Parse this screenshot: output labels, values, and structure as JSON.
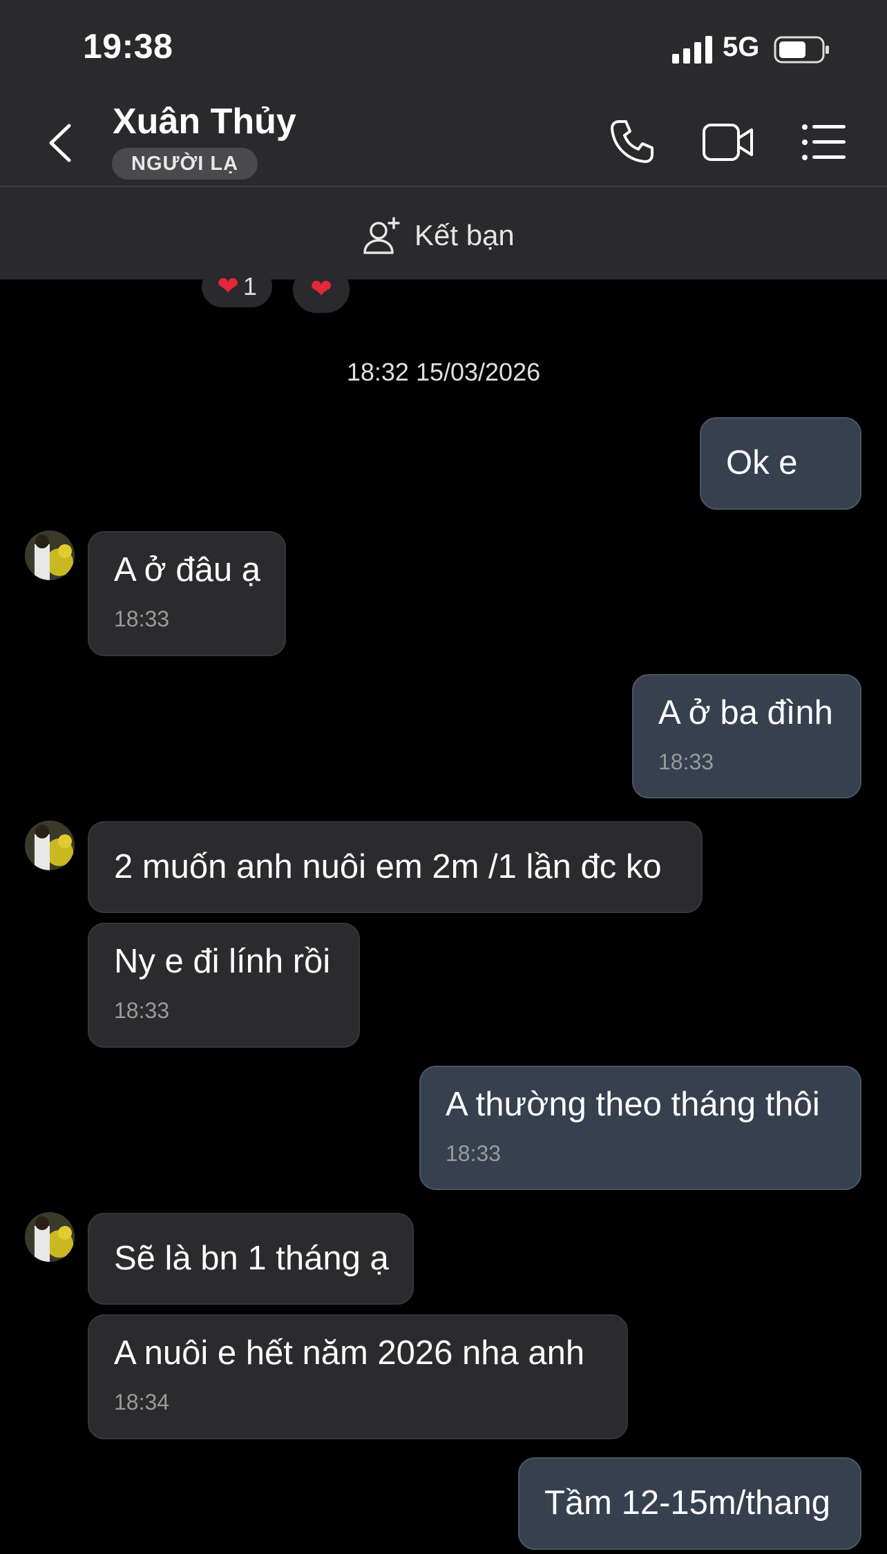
{
  "status_bar": {
    "time": "19:38",
    "network": "5G"
  },
  "header": {
    "contact_name": "Xuân Thủy",
    "badge": "NGƯỜI LẠ",
    "icons": [
      "back-icon",
      "phone-icon",
      "video-camera-icon",
      "list-menu-icon"
    ]
  },
  "add_friend": {
    "label": "Kết bạn",
    "icon": "add-user-icon"
  },
  "reactions": [
    {
      "emoji": "❤",
      "count": "1"
    },
    {
      "emoji": "❤"
    }
  ],
  "date_divider": "18:32 15/03/2026",
  "messages": [
    {
      "dir": "out",
      "text": "Ok e"
    },
    {
      "dir": "in",
      "text": "A ở đâu ạ",
      "time": "18:33"
    },
    {
      "dir": "out",
      "text": "A ở ba đình",
      "time": "18:33"
    },
    {
      "dir": "in",
      "text": "2 muốn anh nuôi em 2m /1 lần đc ko"
    },
    {
      "dir": "in",
      "text": "Ny e đi lính rồi",
      "time": "18:33"
    },
    {
      "dir": "out",
      "text": "A thường theo tháng thôi",
      "time": "18:33"
    },
    {
      "dir": "in",
      "text": "Sẽ là bn 1 tháng ạ"
    },
    {
      "dir": "in",
      "text": "A nuôi e hết năm 2026 nha anh",
      "time": "18:34"
    },
    {
      "dir": "out",
      "text": "Tầm 12-15m/thang"
    }
  ],
  "colors": {
    "header_bg": "#2a2a2c",
    "chat_bg": "#000000",
    "incoming_bubble": "#2b2b2d",
    "outgoing_bubble": "#36404e",
    "heart": "#e2283a"
  }
}
